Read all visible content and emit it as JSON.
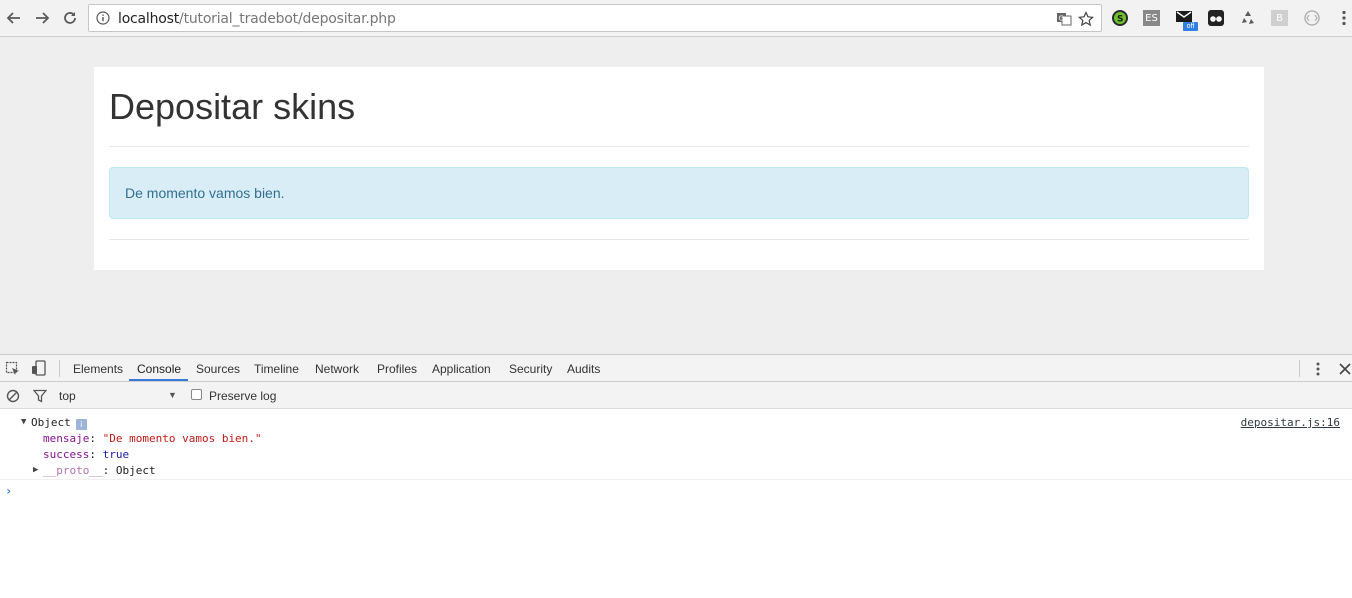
{
  "browser": {
    "url_host": "localhost",
    "url_path": "/tutorial_tradebot/depositar.php",
    "extensions": {
      "es_label": "ES",
      "off_badge": "off",
      "b_label": "B"
    }
  },
  "page": {
    "title": "Depositar skins",
    "alert_message": "De momento vamos bien.",
    "alert_colors": {
      "background": "#d9edf7",
      "border": "#bce8f1",
      "text": "#31708f"
    }
  },
  "devtools": {
    "tabs": [
      {
        "label": "Elements"
      },
      {
        "label": "Console"
      },
      {
        "label": "Sources"
      },
      {
        "label": "Timeline"
      },
      {
        "label": "Network"
      },
      {
        "label": "Profiles"
      },
      {
        "label": "Application"
      },
      {
        "label": "Security"
      },
      {
        "label": "Audits"
      }
    ],
    "active_tab": "Console",
    "context": "top",
    "preserve_log_label": "Preserve log",
    "preserve_log_checked": false,
    "console": {
      "object_label": "Object",
      "info_badge": "i",
      "source_link": "depositar.js:16",
      "properties": [
        {
          "key": "mensaje",
          "value": "\"De momento vamos bien.\""
        },
        {
          "key": "success",
          "value": "true"
        }
      ],
      "proto_key": "__proto__",
      "proto_value": "Object",
      "prompt": "›"
    }
  }
}
